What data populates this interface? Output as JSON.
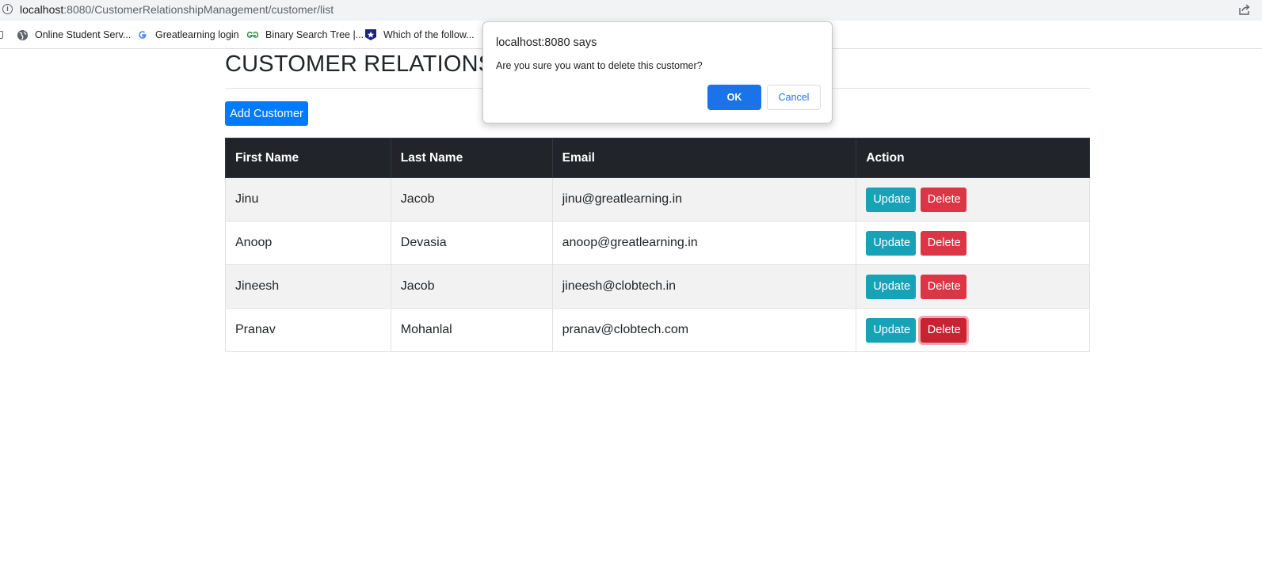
{
  "browser": {
    "url_host": "localhost",
    "url_rest": ":8080/CustomerRelationshipManagement/customer/list",
    "bookmarks": [
      {
        "label": "Online Student Serv...",
        "icon": "globe-icon"
      },
      {
        "label": "Greatlearning login",
        "icon": "google-icon"
      },
      {
        "label": "Binary Search Tree |...",
        "icon": "geeksforgeeks-icon"
      },
      {
        "label": "Which of the follow...",
        "icon": "star-shield-icon"
      }
    ]
  },
  "page": {
    "title": "CUSTOMER RELATIONSHI",
    "add_button_label": "Add Customer"
  },
  "table": {
    "headers": [
      "First Name",
      "Last Name",
      "Email",
      "Action"
    ],
    "rows": [
      {
        "first_name": "Jinu",
        "last_name": "Jacob",
        "email": "jinu@greatlearning.in"
      },
      {
        "first_name": "Anoop",
        "last_name": "Devasia",
        "email": "anoop@greatlearning.in"
      },
      {
        "first_name": "Jineesh",
        "last_name": "Jacob",
        "email": "jineesh@clobtech.in"
      },
      {
        "first_name": "Pranav",
        "last_name": "Mohanlal",
        "email": "pranav@clobtech.com"
      }
    ],
    "update_label": "Update",
    "delete_label": "Delete"
  },
  "dialog": {
    "title": "localhost:8080 says",
    "message": "Are you sure you want to delete this customer?",
    "ok_label": "OK",
    "cancel_label": "Cancel"
  },
  "colors": {
    "primary": "#007bff",
    "info": "#17a2b8",
    "danger": "#dc3545",
    "table_header": "#212529",
    "dialog_ok": "#1a73e8"
  }
}
